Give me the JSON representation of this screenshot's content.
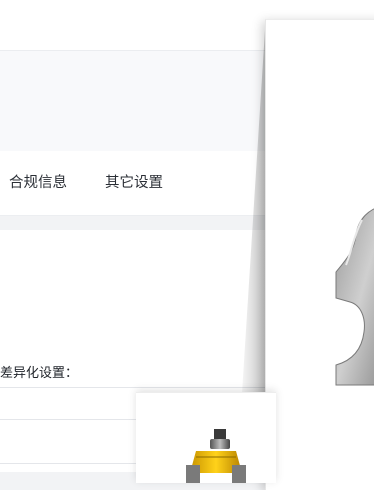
{
  "tabs": {
    "compliance": "合规信息",
    "other_settings": "其它设置"
  },
  "form": {
    "difference_settings_label": "差异化设置："
  },
  "popups": {
    "large_image": {
      "icon": "router-bit-profile-image"
    },
    "small_image": {
      "icon": "router-bit-tool-image"
    }
  }
}
